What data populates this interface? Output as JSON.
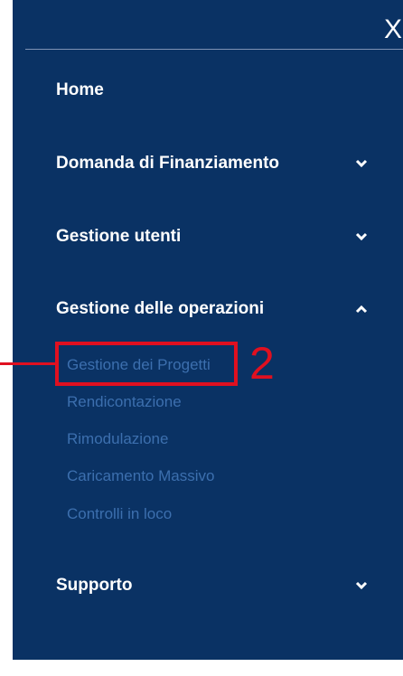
{
  "nav": {
    "close_label": "X",
    "items": [
      {
        "label": "Home"
      },
      {
        "label": "Domanda di Finanziamento",
        "chevron": "chevron-down-icon"
      },
      {
        "label": "Gestione utenti",
        "chevron": "chevron-down-icon"
      },
      {
        "label": "Gestione delle operazioni",
        "chevron": "chevron-up-icon",
        "subitems": [
          {
            "label": "Gestione dei Progetti"
          },
          {
            "label": "Rendicontazione"
          },
          {
            "label": "Rimodulazione"
          },
          {
            "label": "Caricamento Massivo"
          },
          {
            "label": "Controlli in loco"
          }
        ]
      },
      {
        "label": "Supporto",
        "chevron": "chevron-down-icon"
      }
    ]
  },
  "annotation": {
    "number": "2",
    "color": "#e01020"
  },
  "colors": {
    "panel": "#0a3264",
    "subitem": "#3c6fae",
    "text": "#ffffff"
  }
}
